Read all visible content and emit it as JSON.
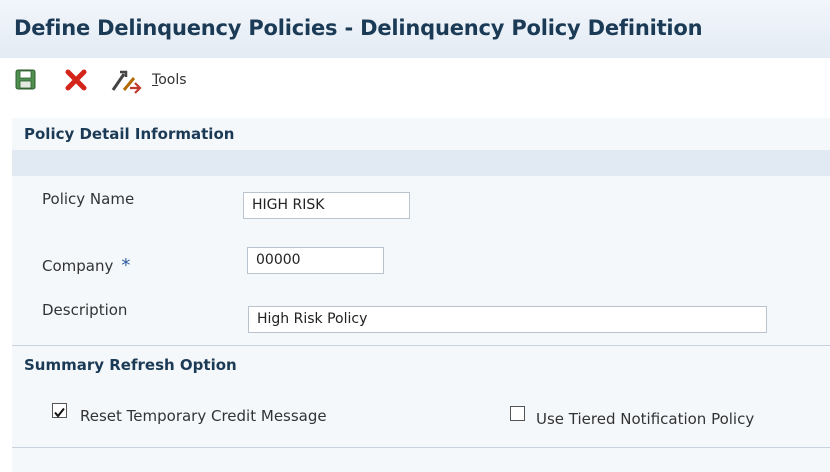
{
  "window": {
    "title": "Define Delinquency Policies - Delinquency Policy Definition"
  },
  "toolbar": {
    "save_icon": "floppy-disk-icon",
    "cancel_icon": "red-x-icon",
    "tools_icon": "tools-icon",
    "tools_label_hotkey": "T",
    "tools_label_rest": "ools"
  },
  "policy_detail": {
    "heading": "Policy Detail Information",
    "policy_name": {
      "label": "Policy Name",
      "value": "HIGH RISK"
    },
    "company": {
      "label": "Company",
      "required_marker": "*",
      "value": "00000"
    },
    "description": {
      "label": "Description",
      "value": "High Risk Policy"
    }
  },
  "summary_refresh": {
    "heading": "Summary Refresh Option",
    "reset_temp_credit": {
      "label": "Reset Temporary Credit Message",
      "checked": true
    },
    "tiered_notification": {
      "label": "Use Tiered Notification Policy",
      "checked": false
    }
  },
  "colors": {
    "heading": "#1b3a55",
    "band": "#e1e9f2",
    "panel": "#f5f8fb",
    "cancel_red": "#d4251b",
    "save_green": "#3d7a3d"
  }
}
